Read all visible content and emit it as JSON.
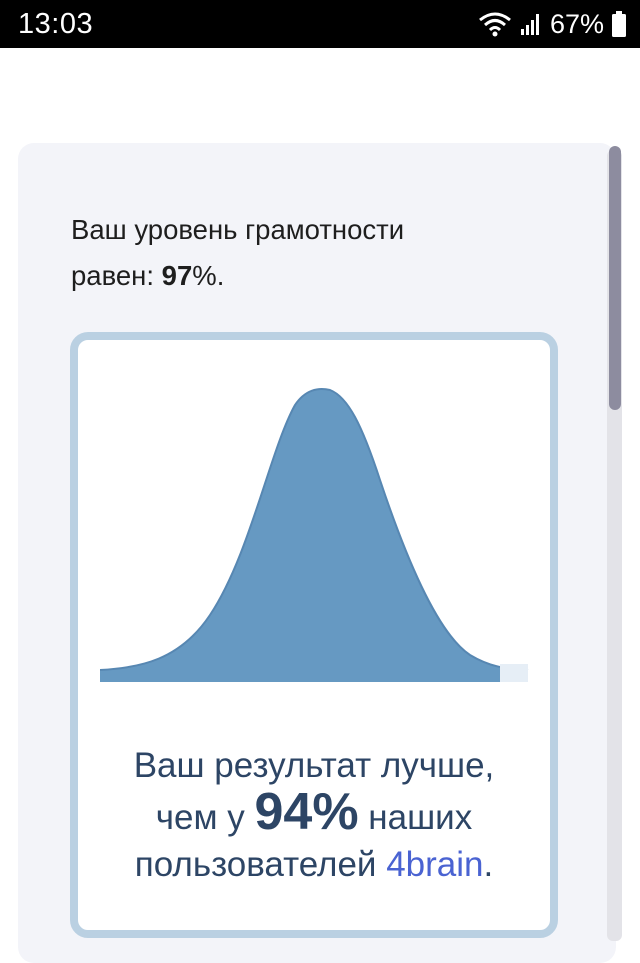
{
  "status_bar": {
    "time": "13:03",
    "battery": "67%",
    "icons": [
      "wifi-icon",
      "signal-icon",
      "battery-icon"
    ]
  },
  "result": {
    "intro_line1": "Ваш уровень грамотности",
    "intro_line2_prefix": "равен: ",
    "score": "97",
    "score_suffix": "%.",
    "comparison_line1": "Ваш результат лучше,",
    "comparison_prefix": "чем у ",
    "percentile": "94%",
    "comparison_suffix": " наших",
    "comparison_line3_prefix": "пользователей ",
    "brand": "4brain",
    "comparison_line3_suffix": "."
  },
  "colors": {
    "curve_fill": "#6699c2",
    "frame_border": "#bad0e2",
    "brand": "#4a63d2",
    "result_text": "#2d4565"
  }
}
